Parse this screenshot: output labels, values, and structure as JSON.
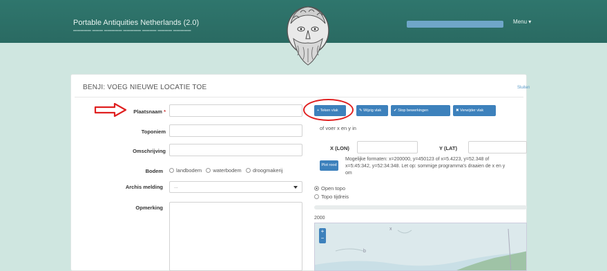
{
  "navbar": {
    "brand": "Portable Antiquities Netherlands (2.0)",
    "menu_label": "Menu ▾"
  },
  "card": {
    "title": "BENJI: VOEG NIEUWE LOCATIE TOE",
    "link": "Sluiten"
  },
  "form": {
    "plaatsnaam_label": "Plaatsnaam",
    "required_mark": "*",
    "toponiem_label": "Toponiem",
    "omschrijving_label": "Omschrijving",
    "bodem_label": "Bodem",
    "bodem_options": [
      "landbodem",
      "waterbodem",
      "droogmakerij"
    ],
    "archis_label": "Archis melding",
    "archis_value": "...",
    "opmerking_label": "Opmerking"
  },
  "map_tools": {
    "buttons": [
      "+ Teken vlak",
      "✎ Wijzig vlak",
      "✔ Stop bewerkingen",
      "✖ Verwijder vlak"
    ],
    "or_text": "of voer x en y in",
    "x_label": "X (LON)",
    "y_label": "Y (LAT)",
    "find_button": "Plot rood",
    "formats_text": "Mogelijke formaten: x=200000, y=450123 of x=5.4223, y=52.348 of x=5:45:342, y=52:34:348. Let op: sommige programma's draaien de x en y om",
    "layer_options": [
      "Open topo",
      "Topo tijdreis"
    ],
    "year": "2000",
    "zoom_in": "+",
    "zoom_out": "−"
  },
  "colors": {
    "navbar": "#2d7269",
    "accent_button": "#3d81bc",
    "annotation": "#e02020"
  }
}
